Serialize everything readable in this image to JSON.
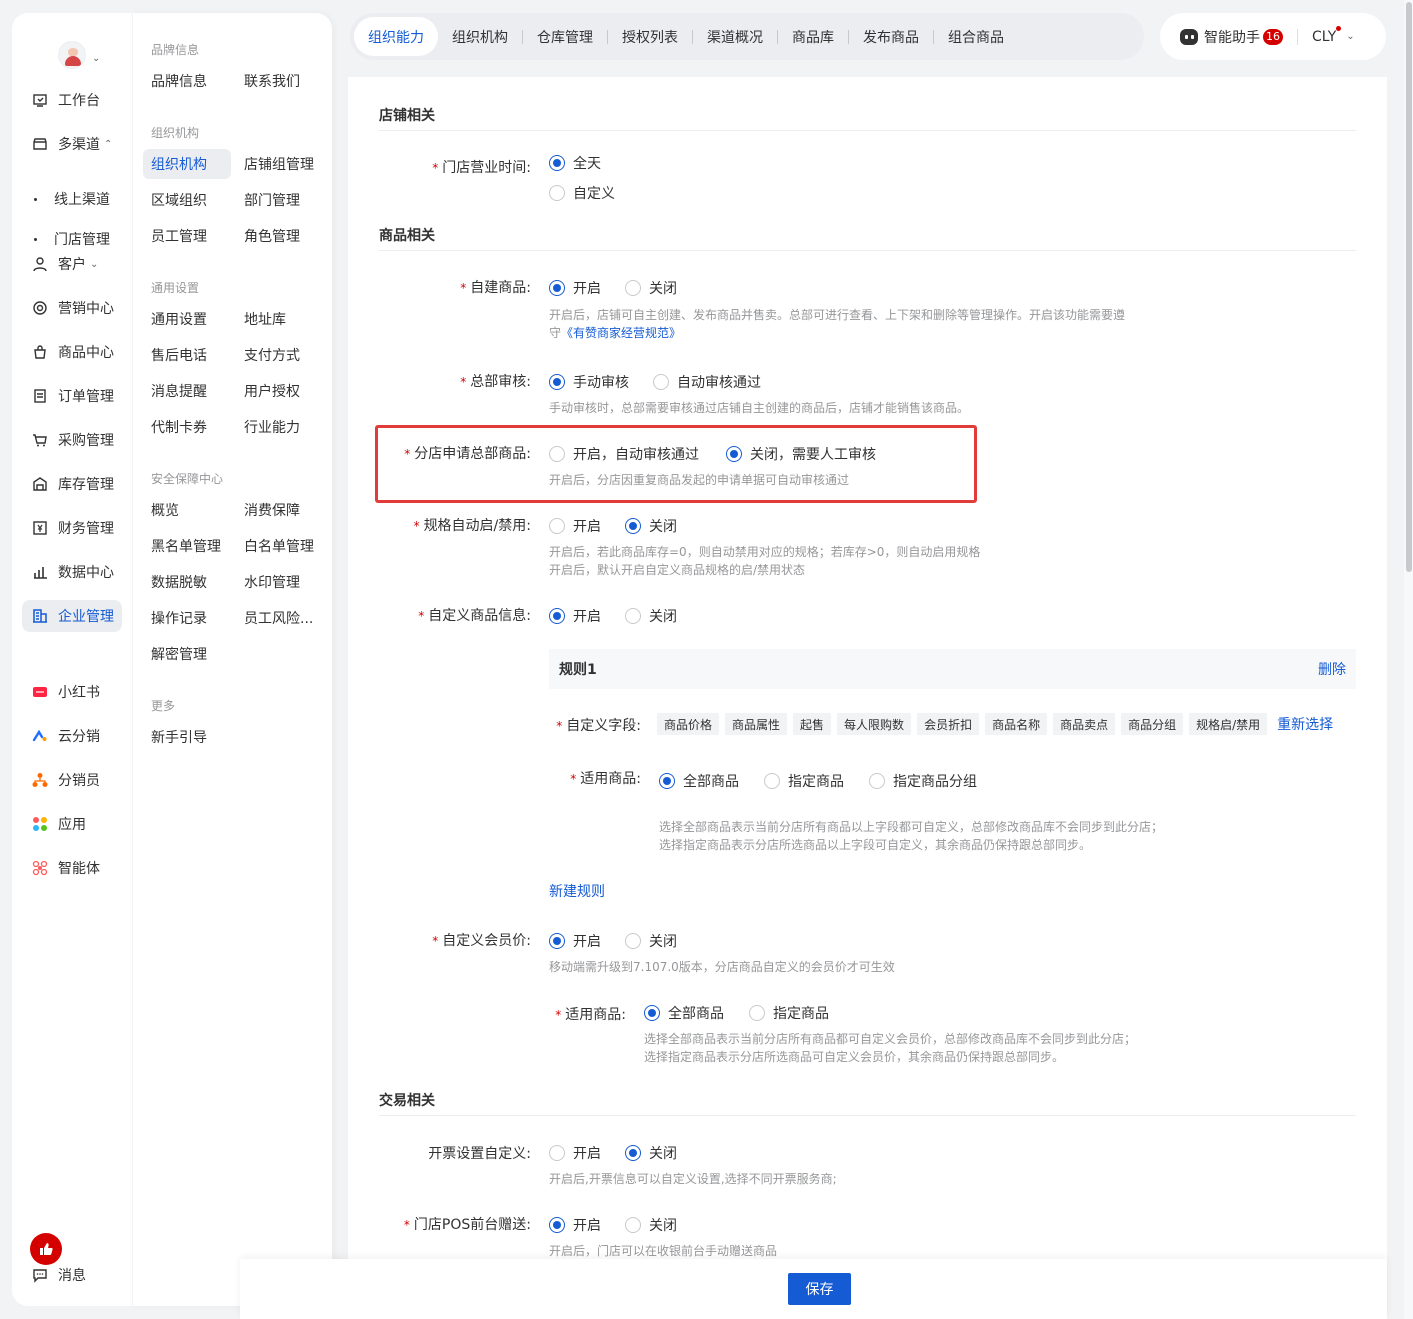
{
  "nav1": {
    "items": [
      {
        "label": "工作台",
        "icon": "workbench-icon"
      },
      {
        "label": "多渠道",
        "icon": "store-icon",
        "caret": "⌃"
      },
      {
        "label": "客户",
        "icon": "user-icon",
        "caret": "⌄"
      },
      {
        "label": "营销中心",
        "icon": "marketing-icon"
      },
      {
        "label": "商品中心",
        "icon": "bag-icon"
      },
      {
        "label": "订单管理",
        "icon": "order-icon"
      },
      {
        "label": "采购管理",
        "icon": "cart-icon"
      },
      {
        "label": "库存管理",
        "icon": "warehouse-icon"
      },
      {
        "label": "财务管理",
        "icon": "finance-icon"
      },
      {
        "label": "数据中心",
        "icon": "chart-icon"
      },
      {
        "label": "企业管理",
        "icon": "enterprise-icon"
      },
      {
        "label": "小红书",
        "icon": "xiaohongshu-icon"
      },
      {
        "label": "云分销",
        "icon": "cloud-distribution-icon"
      },
      {
        "label": "分销员",
        "icon": "distributor-icon"
      },
      {
        "label": "应用",
        "icon": "apps-icon"
      },
      {
        "label": "智能体",
        "icon": "agent-icon"
      }
    ],
    "sub": [
      "线上渠道",
      "门店管理"
    ],
    "messages": "消息"
  },
  "nav2": {
    "groups": [
      "品牌信息",
      "组织机构",
      "通用设置",
      "安全保障中心",
      "更多"
    ],
    "items": [
      "品牌信息",
      "联系我们",
      "组织机构",
      "店铺组管理",
      "区域组织",
      "部门管理",
      "员工管理",
      "角色管理",
      "通用设置",
      "地址库",
      "售后电话",
      "支付方式",
      "消息提醒",
      "用户授权",
      "代制卡券",
      "行业能力",
      "概览",
      "消费保障",
      "黑名单管理",
      "白名单管理",
      "数据脱敏",
      "水印管理",
      "操作记录",
      "员工风险...",
      "解密管理",
      "新手引导"
    ]
  },
  "tabs": [
    "组织能力",
    "组织机构",
    "仓库管理",
    "授权列表",
    "渠道概况",
    "商品库",
    "发布商品",
    "组合商品"
  ],
  "topright": {
    "assistant": "智能助手",
    "badge": "16",
    "user": "CLY"
  },
  "form": {
    "sections": [
      "店铺相关",
      "商品相关",
      "交易相关"
    ],
    "hours": {
      "label": "门店营业时间:",
      "options": [
        "全天",
        "自定义"
      ]
    },
    "self_goods": {
      "label": "自建商品:",
      "on": "开启",
      "off": "关闭",
      "help1": "开启后，店铺可自主创建、发布商品并售卖。总部可进行查看、上下架和删除等管理操作。开启该功能需要遵",
      "help2a": "守",
      "help2_link": "《有赞商家经营规范》"
    },
    "review": {
      "label": "总部审核:",
      "manual": "手动审核",
      "auto": "自动审核通过",
      "help": "手动审核时，总部需要审核通过店铺自主创建的商品后，店铺才能销售该商品。"
    },
    "branch_apply": {
      "label": "分店申请总部商品:",
      "on": "开启，自动审核通过",
      "off": "关闭，需要人工审核",
      "help": "开启后，分店因重复商品发起的申请单据可自动审核通过"
    },
    "spec_auto": {
      "label": "规格自动启/禁用:",
      "on": "开启",
      "off": "关闭",
      "help1": "开启后，若此商品库存=0，则自动禁用对应的规格；若库存>0，则自动启用规格",
      "help2": "开启后，默认开启自定义商品规格的启/禁用状态"
    },
    "custom_info": {
      "label": "自定义商品信息:",
      "on": "开启",
      "off": "关闭"
    },
    "rule": {
      "title": "规则1",
      "delete": "删除",
      "fields_label": "自定义字段:",
      "tags": [
        "商品价格",
        "商品属性",
        "起售",
        "每人限购数",
        "会员折扣",
        "商品名称",
        "商品卖点",
        "商品分组",
        "规格启/禁用"
      ],
      "reselect": "重新选择",
      "scope_label": "适用商品:",
      "scope_opts": [
        "全部商品",
        "指定商品",
        "指定商品分组"
      ],
      "help1": "选择全部商品表示当前分店所有商品以上字段都可自定义，总部修改商品库不会同步到此分店；",
      "help2": "选择指定商品表示分店所选商品以上字段可自定义，其余商品仍保持跟总部同步。",
      "new_rule": "新建规则"
    },
    "member_price": {
      "label": "自定义会员价:",
      "on": "开启",
      "off": "关闭",
      "help": "移动端需升级到7.107.0版本，分店商品自定义的会员价才可生效",
      "scope_label": "适用商品:",
      "scope_opts": [
        "全部商品",
        "指定商品"
      ],
      "help1": "选择全部商品表示当前分店所有商品都可自定义会员价，总部修改商品库不会同步到此分店；",
      "help2": "选择指定商品表示分店所选商品可自定义会员价，其余商品仍保持跟总部同步。"
    },
    "invoice": {
      "label": "开票设置自定义:",
      "on": "开启",
      "off": "关闭",
      "help": "开启后,开票信息可以自定义设置,选择不同开票服务商;"
    },
    "pos_gift": {
      "label": "门店POS前台赠送:",
      "on": "开启",
      "off": "关闭",
      "help": "开启后，门店可以在收银前台手动赠送商品"
    }
  },
  "footer": {
    "save": "保存"
  },
  "colors": {
    "accent": "#155bd4",
    "required": "#d40000",
    "highlight": "#e23c39"
  }
}
